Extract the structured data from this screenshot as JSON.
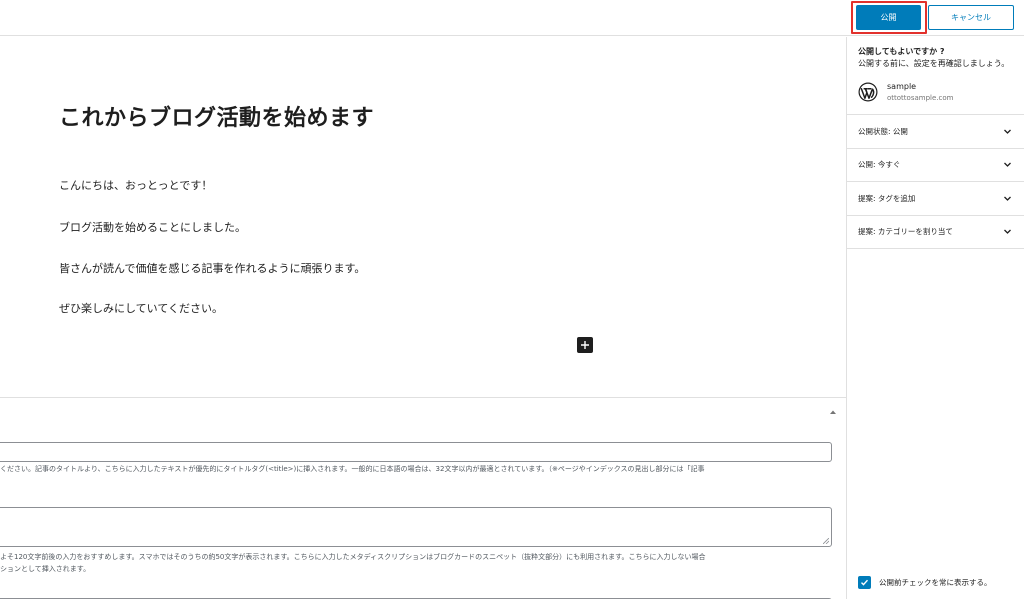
{
  "header": {
    "publish_label": "公開",
    "cancel_label": "キャンセル"
  },
  "post": {
    "title": "これからブログ活動を始めます",
    "paragraphs": [
      "こんにちは、おっとっとです！",
      "ブログ活動を始めることにしました。",
      "皆さんが読んで価値を感じる記事を作れるように頑張ります。",
      "ぜひ楽しみにしていてください。"
    ]
  },
  "meta_box": {
    "title_help": "ください。記事のタイトルより、こちらに入力したテキストが優先的にタイトルタグ(<title>)に挿入されます。一般的に日本語の場合は、32文字以内が最適とされています。（※ページやインデックスの見出し部分には「記事",
    "title_value": "",
    "desc_help_1": "よそ120文字前後の入力をおすすめします。スマホではそのうちの約50文字が表示されます。こちらに入力したメタディスクリプションはブログカードのスニペット（抜粋文部分）にも利用されます。こちらに入力しない場合",
    "desc_help_2": "ションとして挿入されます。",
    "desc_value": ""
  },
  "sidebar": {
    "prepublish_title": "公開してもよいですか ?",
    "prepublish_sub": "公開する前に、設定を再確認しましょう。",
    "site_name": "sample",
    "site_url": "ottottosample.com",
    "panels": [
      {
        "label": "公開状態: 公開"
      },
      {
        "label": "公開: 今すぐ"
      },
      {
        "label": "提案: タグを追加"
      },
      {
        "label": "提案: カテゴリーを割り当て"
      }
    ],
    "always_show_label": "公開前チェックを常に表示する。"
  },
  "colors": {
    "accent": "#007cba",
    "highlight": "#e2312c"
  }
}
